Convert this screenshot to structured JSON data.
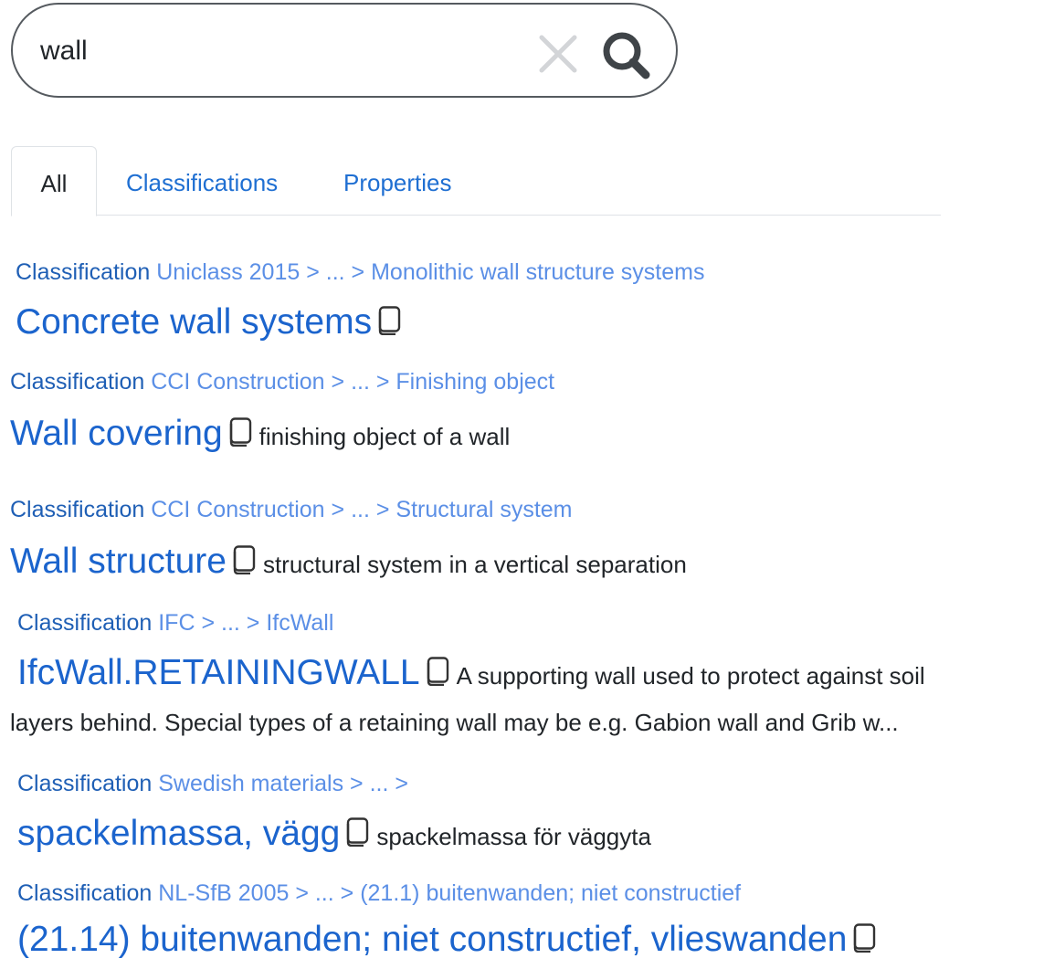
{
  "search": {
    "value": "wall",
    "clear_icon": "close-icon",
    "search_icon": "search-icon"
  },
  "tabs": [
    {
      "label": "All",
      "active": true
    },
    {
      "label": "Classifications",
      "active": false
    },
    {
      "label": "Properties",
      "active": false
    }
  ],
  "results": [
    {
      "type": "Classification",
      "path": "Uniclass 2015 > ... > Monolithic wall structure systems",
      "title": "Concrete wall systems",
      "description": ""
    },
    {
      "type": "Classification",
      "path": "CCI Construction > ... > Finishing object",
      "title": "Wall covering",
      "description": "finishing object of a wall"
    },
    {
      "type": "Classification",
      "path": "CCI Construction > ... > Structural system",
      "title": "Wall structure",
      "description": "structural system in a vertical separation"
    },
    {
      "type": "Classification",
      "path": "IFC > ... > IfcWall",
      "title": "IfcWall.RETAININGWALL",
      "description": "A supporting wall used to protect against soil",
      "description_line2": "layers behind. Special types of a retaining wall may be e.g. Gabion wall and Grib w..."
    },
    {
      "type": "Classification",
      "path": "Swedish materials > ... >",
      "title": "spackelmassa, vägg",
      "description": "spackelmassa för väggyta"
    },
    {
      "type": "Classification",
      "path": "NL-SfB 2005 > ... > (21.1) buitenwanden; niet constructief",
      "title": "(21.14) buitenwanden; niet constructief, vlieswanden",
      "description": ""
    }
  ],
  "colors": {
    "link": "#1b64cd",
    "path": "#5b8fe6",
    "text": "#212529",
    "border": "#555a5f"
  }
}
